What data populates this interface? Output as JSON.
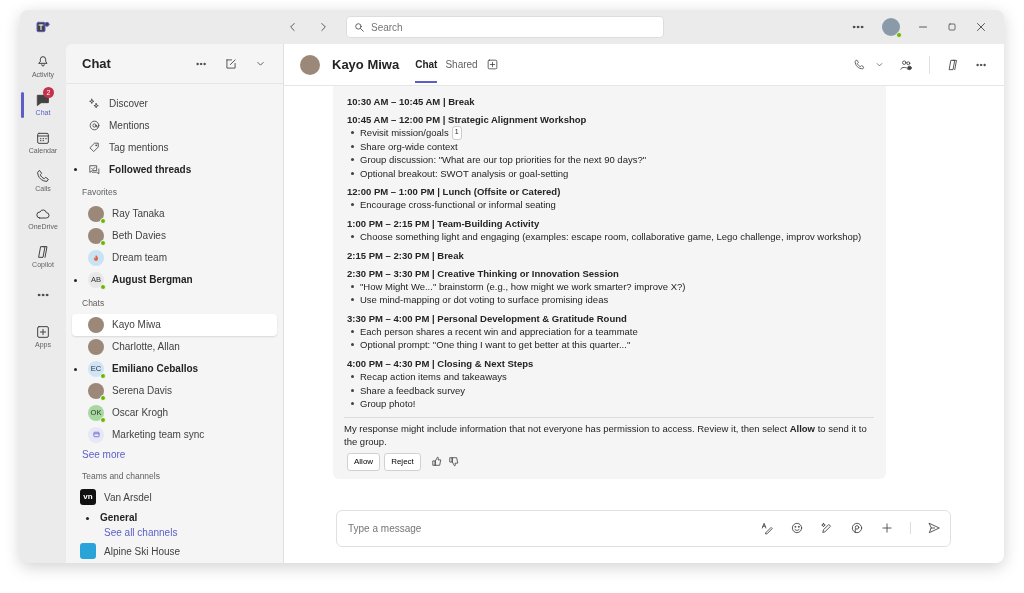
{
  "search": {
    "placeholder": "Search"
  },
  "app_rail": [
    {
      "label": "Activity",
      "selected": false
    },
    {
      "label": "Chat",
      "selected": true,
      "badge": "2"
    },
    {
      "label": "Calendar",
      "selected": false
    },
    {
      "label": "Calls",
      "selected": false
    },
    {
      "label": "OneDrive",
      "selected": false
    },
    {
      "label": "Copilot",
      "selected": false
    },
    {
      "selected": false
    },
    {
      "label": "Apps",
      "selected": false
    }
  ],
  "chat_list": {
    "title": "Chat",
    "nav": [
      {
        "label": "Discover",
        "unread": false
      },
      {
        "label": "Mentions",
        "unread": false
      },
      {
        "label": "Tag mentions",
        "unread": false
      },
      {
        "label": "Followed threads",
        "unread": true
      }
    ],
    "sections": [
      {
        "title": "Favorites",
        "items": [
          {
            "name": "Ray Tanaka",
            "kind": "photo",
            "online": true,
            "unread": false,
            "selected": false
          },
          {
            "name": "Beth Davies",
            "kind": "photo",
            "online": true,
            "unread": false,
            "selected": false
          },
          {
            "name": "Dream team",
            "kind": "group",
            "online": false,
            "unread": false,
            "selected": false
          },
          {
            "name": "August Bergman",
            "kind": "initials",
            "initials": "AB",
            "color": "#e8e8e8",
            "online": true,
            "unread": true,
            "selected": false
          }
        ]
      },
      {
        "title": "Chats",
        "items": [
          {
            "name": "Kayo Miwa",
            "kind": "photo",
            "online": false,
            "unread": false,
            "selected": true
          },
          {
            "name": "Charlotte, Allan",
            "kind": "photo",
            "online": false,
            "unread": false,
            "selected": false
          },
          {
            "name": "Emiliano Ceballos",
            "kind": "initials",
            "initials": "EC",
            "color": "#cfe4f7",
            "online": true,
            "unread": true,
            "selected": false
          },
          {
            "name": "Serena Davis",
            "kind": "photo",
            "online": true,
            "unread": false,
            "selected": false
          },
          {
            "name": "Oscar Krogh",
            "kind": "initials",
            "initials": "OK",
            "color": "#a7d8a0",
            "online": true,
            "unread": false,
            "selected": false
          },
          {
            "name": "Marketing team sync",
            "kind": "meeting",
            "online": false,
            "unread": false,
            "selected": false
          }
        ],
        "link": "See more"
      },
      {
        "title": "Teams and channels",
        "teams": [
          {
            "name": "Van Arsdel",
            "logo": "vn",
            "color": "#111111",
            "channels": [
              {
                "name": "General",
                "unread": true
              }
            ],
            "link": "See all channels"
          },
          {
            "name": "Alpine Ski House",
            "color": "#2aa3d8"
          }
        ]
      }
    ]
  },
  "conversation": {
    "name": "Kayo Miwa",
    "tabs": [
      {
        "label": "Chat",
        "selected": true
      },
      {
        "label": "Shared",
        "selected": false
      }
    ],
    "message": {
      "blocks": [
        {
          "heading": "10:30 AM – 10:45 AM | Break"
        },
        {
          "heading": "10:45 AM – 12:00 PM | Strategic Alignment Workshop",
          "bullets": [
            {
              "text": "Revisit mission/goals",
              "citation": "1"
            },
            {
              "text": "Share org-wide context"
            },
            {
              "text": "Group discussion: \"What are our top priorities for the next 90 days?\""
            },
            {
              "text": "Optional breakout: SWOT analysis or goal-setting"
            }
          ]
        },
        {
          "heading": "12:00 PM – 1:00 PM | Lunch (Offsite or Catered)",
          "bullets": [
            {
              "text": "Encourage cross-functional or informal seating"
            }
          ]
        },
        {
          "heading": "1:00 PM – 2:15 PM | Team-Building Activity",
          "bullets": [
            {
              "text": "Choose something light and engaging (examples: escape room, collaborative game, Lego challenge, improv workshop)"
            }
          ]
        },
        {
          "heading": "2:15 PM – 2:30 PM | Break"
        },
        {
          "heading": "2:30 PM – 3:30 PM | Creative Thinking or Innovation Session",
          "bullets": [
            {
              "text": "\"How Might We...\" brainstorm (e.g., how might we work smarter? improve X?)"
            },
            {
              "text": "Use mind-mapping or dot voting to surface promising ideas"
            }
          ]
        },
        {
          "heading": "3:30 PM – 4:00 PM | Personal Development & Gratitude Round",
          "bullets": [
            {
              "text": "Each person shares a recent win and appreciation for a teammate"
            },
            {
              "text": "Optional prompt: \"One thing I want to get better at this quarter...\""
            }
          ]
        },
        {
          "heading": "4:00 PM – 4:30 PM | Closing & Next Steps",
          "bullets": [
            {
              "text": "Recap action items and takeaways"
            },
            {
              "text": "Share a feedback survey"
            },
            {
              "text": "Group photo!"
            }
          ]
        }
      ],
      "notice": "My response might include information that not everyone has permission to access. Review it, then select **Allow** to send it to the group.",
      "actions": [
        "Allow",
        "Reject"
      ]
    },
    "compose": {
      "placeholder": "Type a message"
    }
  }
}
